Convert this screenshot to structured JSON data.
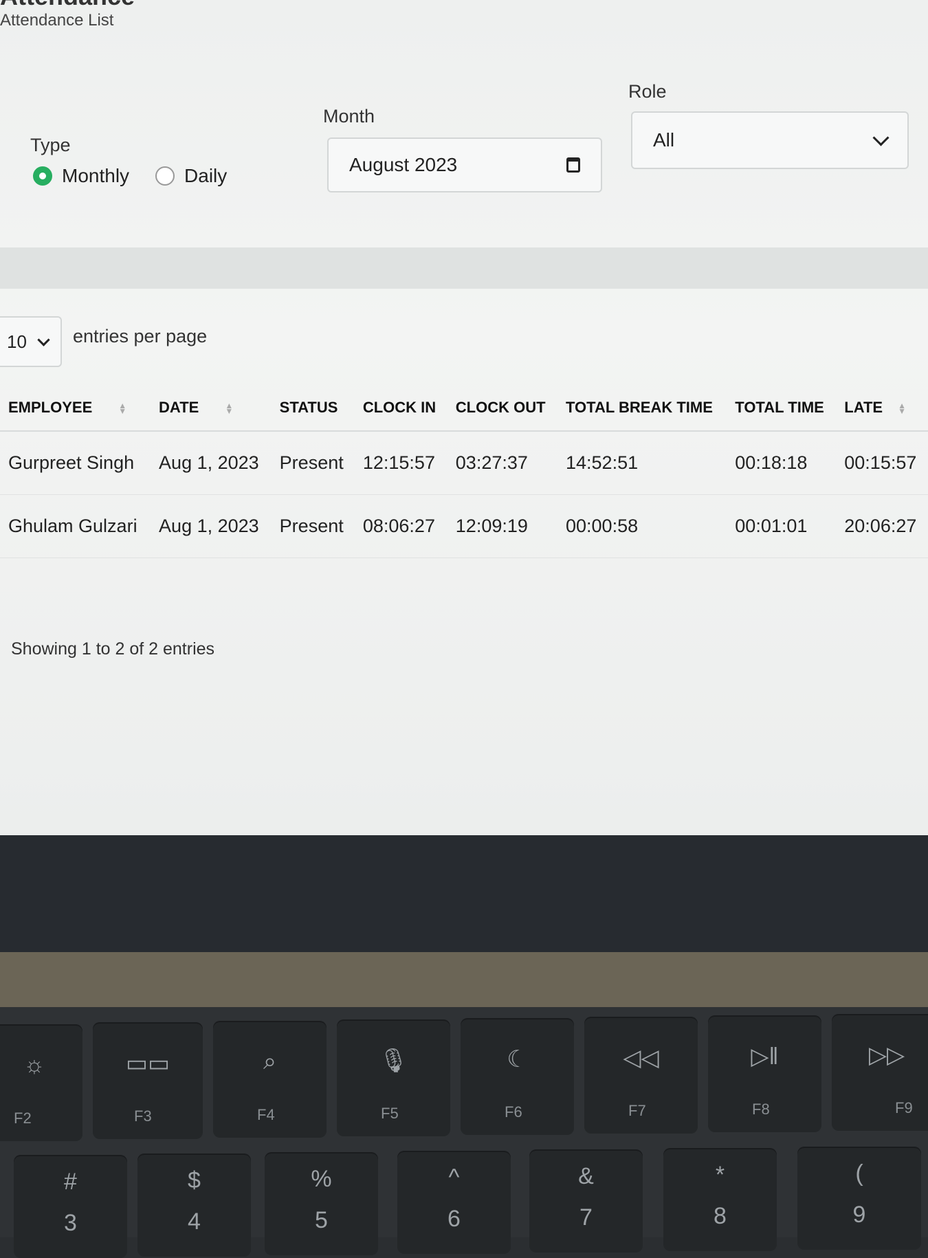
{
  "page": {
    "title": "Attendance",
    "breadcrumb": "Attendance List"
  },
  "filters": {
    "type_label": "Type",
    "type_options": [
      {
        "label": "Monthly",
        "checked": true
      },
      {
        "label": "Daily",
        "checked": false
      }
    ],
    "month_label": "Month",
    "month_value": "August 2023",
    "role_label": "Role",
    "role_value": "All"
  },
  "table": {
    "entries_per_page_value": "10",
    "entries_per_page_label": "entries per page",
    "columns": [
      "EMPLOYEE",
      "DATE",
      "STATUS",
      "CLOCK IN",
      "CLOCK OUT",
      "TOTAL BREAK TIME",
      "TOTAL TIME",
      "LATE"
    ],
    "rows": [
      [
        "Gurpreet Singh",
        "Aug 1, 2023",
        "Present",
        "12:15:57",
        "03:27:37",
        "14:52:51",
        "00:18:18",
        "00:15:57"
      ],
      [
        "Ghulam Gulzari",
        "Aug 1, 2023",
        "Present",
        "08:06:27",
        "12:09:19",
        "00:00:58",
        "00:01:01",
        "20:06:27"
      ]
    ],
    "showing": "Showing 1 to 2 of 2 entries"
  },
  "keyboard": {
    "function_keys": [
      {
        "fn": "F2",
        "icon": "brightness-icon",
        "glyph": "☼"
      },
      {
        "fn": "F3",
        "icon": "mission-control-icon",
        "glyph": "▭▭"
      },
      {
        "fn": "F4",
        "icon": "search-icon",
        "glyph": "⌕"
      },
      {
        "fn": "F5",
        "icon": "microphone-icon",
        "glyph": "🎙"
      },
      {
        "fn": "F6",
        "icon": "moon-icon",
        "glyph": "☾"
      },
      {
        "fn": "F7",
        "icon": "rewind-icon",
        "glyph": "◁◁"
      },
      {
        "fn": "F8",
        "icon": "play-pause-icon",
        "glyph": "▷ǁ"
      },
      {
        "fn": "F9",
        "icon": "fast-forward-icon",
        "glyph": "▷▷"
      }
    ],
    "number_keys": [
      {
        "top": "#",
        "bottom": "3"
      },
      {
        "top": "$",
        "bottom": "4"
      },
      {
        "top": "%",
        "bottom": "5"
      },
      {
        "top": "^",
        "bottom": "6"
      },
      {
        "top": "&",
        "bottom": "7"
      },
      {
        "top": "*",
        "bottom": "8"
      },
      {
        "top": "(",
        "bottom": "9"
      }
    ]
  }
}
